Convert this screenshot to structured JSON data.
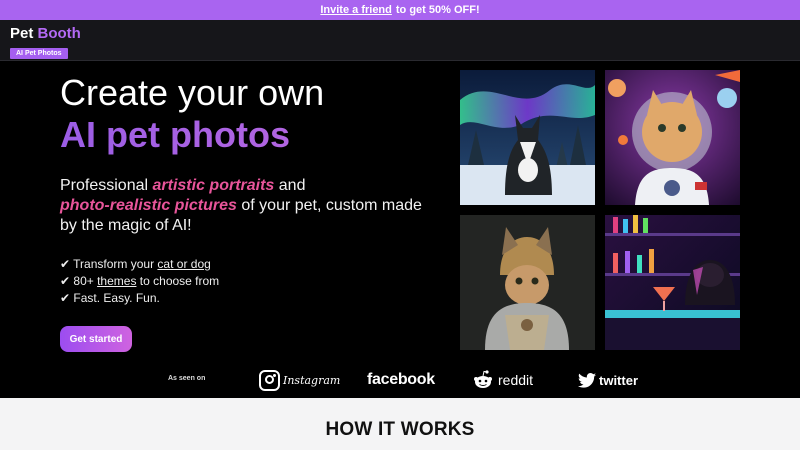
{
  "promo": {
    "link_text": "Invite a friend",
    "rest_text": "to get 50% OFF!"
  },
  "header": {
    "logo_part1": "Pet",
    "logo_part2": "Booth",
    "badge": "AI Pet Photos"
  },
  "hero": {
    "title_line1": "Create your own",
    "title_line2": "AI pet photos",
    "desc_pre": "Professional",
    "desc_hl1": "artistic portraits",
    "desc_mid": "and",
    "desc_hl2": "photo-realistic pictures",
    "desc_post": "of your pet, custom made by the magic of AI!",
    "features": [
      {
        "prefix": "✔ Transform your",
        "link": "cat or dog",
        "suffix": ""
      },
      {
        "prefix": "✔ 80+",
        "link": "themes",
        "suffix": "to choose from"
      },
      {
        "prefix": "✔ Fast. Easy. Fun.",
        "link": "",
        "suffix": ""
      }
    ],
    "cta_label": "Get started"
  },
  "gallery": {
    "images": [
      {
        "icon": "husky-northern-lights-image"
      },
      {
        "icon": "astronaut-cat-image"
      },
      {
        "icon": "knight-cat-image"
      },
      {
        "icon": "dog-bar-cocktail-image"
      }
    ]
  },
  "seen_on": {
    "label": "As seen on",
    "brands": [
      "Instagram",
      "facebook",
      "reddit",
      "twitter"
    ]
  },
  "how": {
    "title": "HOW IT WORKS"
  },
  "colors": {
    "accent": "#a964f0",
    "highlight": "#e8559a",
    "background": "#000000"
  }
}
